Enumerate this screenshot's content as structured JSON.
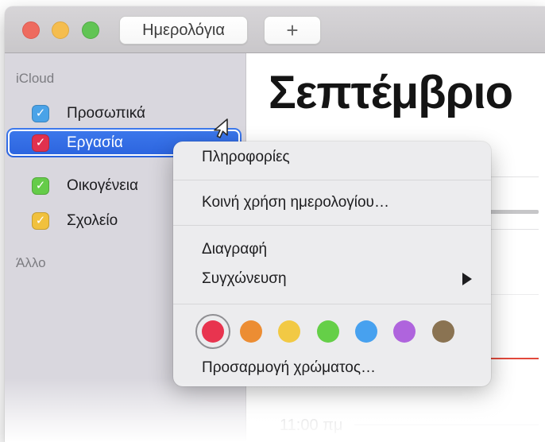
{
  "toolbar": {
    "calendars_label": "Ημερολόγια",
    "add_label": "+"
  },
  "sidebar": {
    "groups": [
      {
        "header": "iCloud",
        "items": [
          {
            "label": "Προσωπικά",
            "color": "#4aa3e8",
            "checked": true,
            "selected": false
          },
          {
            "label": "Εργασία",
            "color": "#e1314e",
            "checked": true,
            "selected": true
          },
          {
            "label": "Οικογένεια",
            "color": "#65cc49",
            "checked": true,
            "selected": false
          },
          {
            "label": "Σχολείο",
            "color": "#f1c13d",
            "checked": true,
            "selected": false
          }
        ]
      },
      {
        "header": "Άλλο",
        "items": []
      }
    ],
    "selection_color": "#2f6be4"
  },
  "main": {
    "title": "Σεπτέμβριο",
    "time_label": "11:00 πμ",
    "current_time_color": "#e2493c"
  },
  "context_menu": {
    "items": [
      {
        "label": "Πληροφορίες"
      },
      {
        "label": "Κοινή χρήση ημερολογίου…"
      },
      {
        "label": "Διαγραφή"
      },
      {
        "label": "Συγχώνευση",
        "has_submenu": true
      }
    ],
    "custom_color_label": "Προσαρμογή χρώματος…",
    "colors": [
      {
        "name": "red",
        "hex": "#e8344f",
        "selected": true
      },
      {
        "name": "orange",
        "hex": "#ec8d33",
        "selected": false
      },
      {
        "name": "yellow",
        "hex": "#f2c944",
        "selected": false
      },
      {
        "name": "green",
        "hex": "#65cf48",
        "selected": false
      },
      {
        "name": "blue",
        "hex": "#47a1ef",
        "selected": false
      },
      {
        "name": "purple",
        "hex": "#af64dd",
        "selected": false
      },
      {
        "name": "brown",
        "hex": "#8a7352",
        "selected": false
      }
    ]
  }
}
